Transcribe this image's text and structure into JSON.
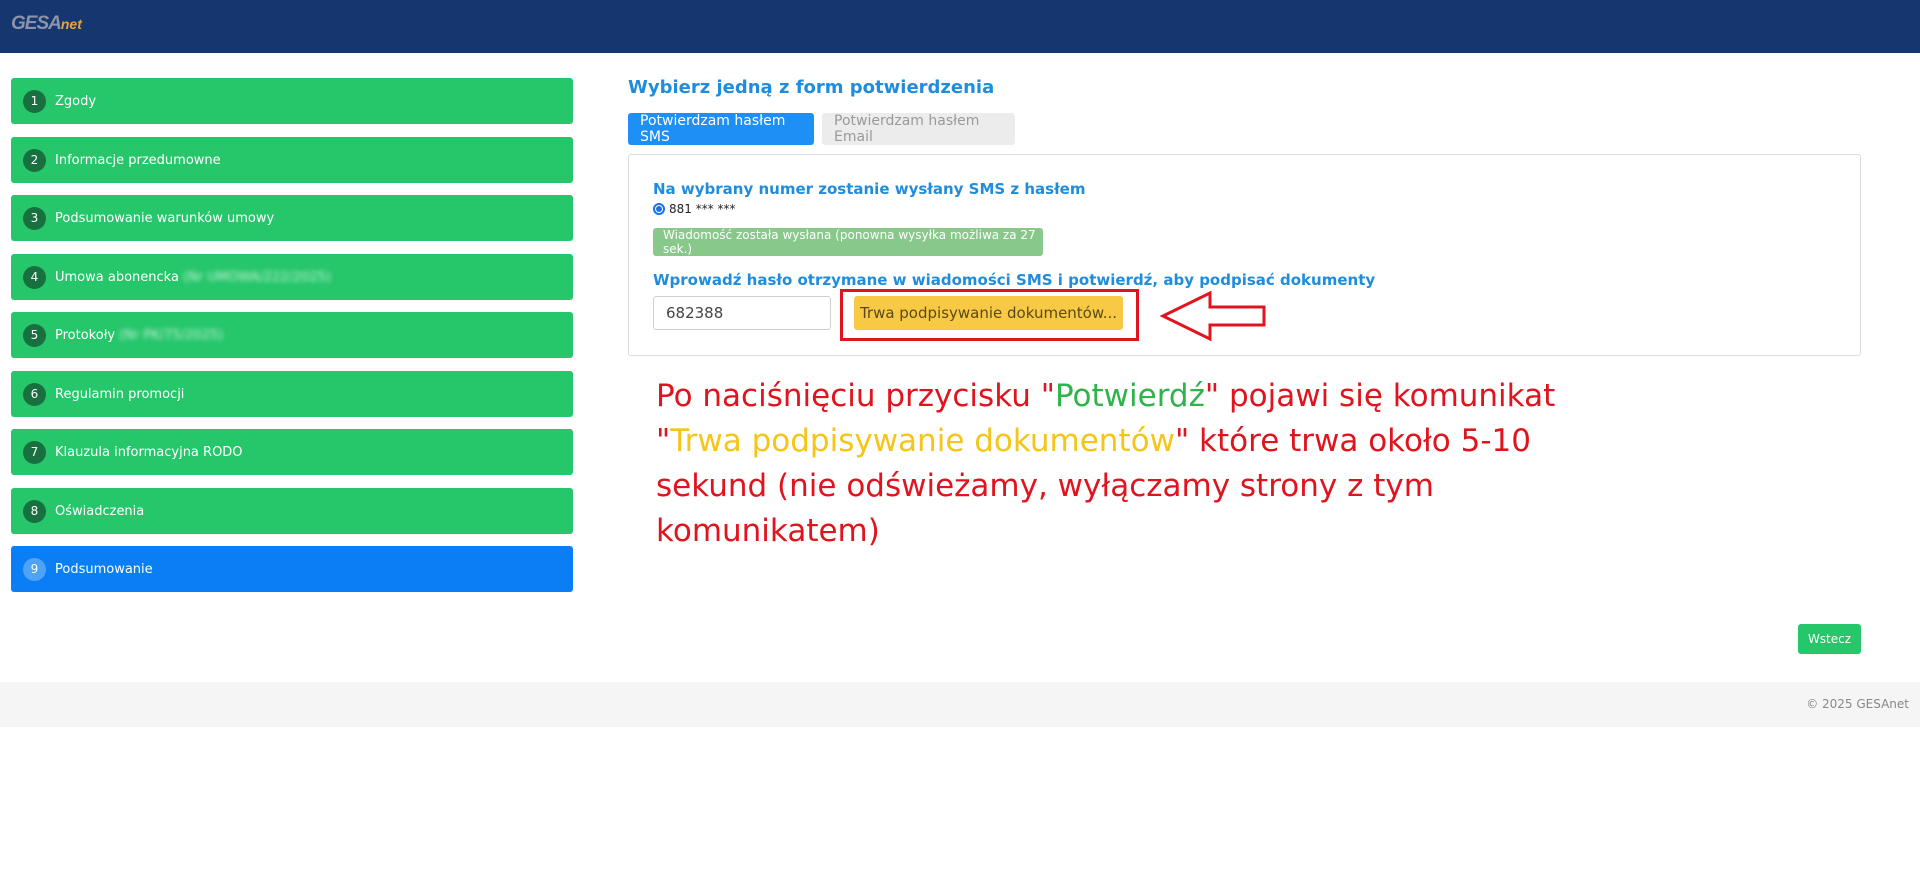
{
  "header": {
    "logo_main": "GESA",
    "logo_suffix": "net"
  },
  "steps": [
    {
      "num": "1",
      "label": "Zgody",
      "blurred": ""
    },
    {
      "num": "2",
      "label": "Informacje przedumowne",
      "blurred": ""
    },
    {
      "num": "3",
      "label": "Podsumowanie warunków umowy",
      "blurred": ""
    },
    {
      "num": "4",
      "label": "Umowa abonencka",
      "blurred": "(Nr UMOWA/222/2025)"
    },
    {
      "num": "5",
      "label": "Protokoły",
      "blurred": "(Nr PK/75/2025)"
    },
    {
      "num": "6",
      "label": "Regulamin promocji",
      "blurred": ""
    },
    {
      "num": "7",
      "label": "Klauzula informacyjna RODO",
      "blurred": ""
    },
    {
      "num": "8",
      "label": "Oświadczenia",
      "blurred": ""
    },
    {
      "num": "9",
      "label": "Podsumowanie",
      "blurred": ""
    }
  ],
  "main": {
    "heading": "Wybierz jedną z form potwierdzenia",
    "tabs": {
      "sms": "Potwierdzam hasłem SMS",
      "email": "Potwierdzam hasłem Email"
    },
    "sms_label": "Na wybrany numer zostanie wysłany SMS z hasłem",
    "phone": "881 *** ***",
    "sent_message": "Wiadomość została wysłana (ponowna wysyłka możliwa za 27 sek.)",
    "code_label": "Wprowadź hasło otrzymane w wiadomości SMS i potwierdź, aby podpisać dokumenty",
    "code_value": "682388",
    "signing_label": "Trwa podpisywanie dokumentów..."
  },
  "annotation": {
    "part1": "Po naciśnięciu przycisku \"",
    "confirm_word": "Potwierdź",
    "part2": "\" pojawi się komunikat \"",
    "signing_word": "Trwa podpisywanie dokumentów",
    "part3": "\" które trwa około 5-10 sekund (nie odświeżamy, wyłączamy strony z tym komunikatem)"
  },
  "back_label": "Wstecz",
  "footer": {
    "copyright": "© 2025 GESAnet"
  },
  "colors": {
    "topbar": "#163670",
    "step": "#26c66b",
    "active_step": "#0a7ff5",
    "accent": "#1f8ddb",
    "annotation": "#e0141e"
  }
}
